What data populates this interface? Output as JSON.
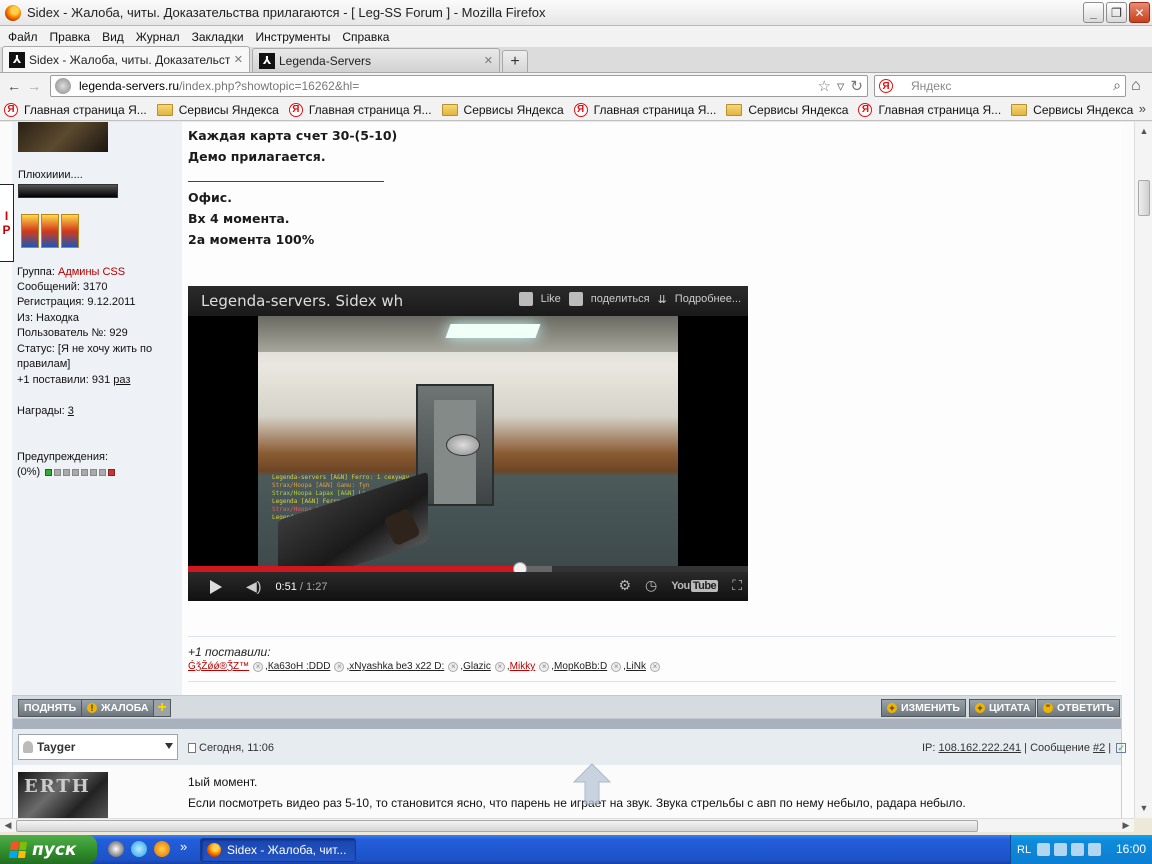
{
  "window": {
    "title": "Sidex - Жалоба, читы. Доказательства прилагаются - [ Leg-SS Forum ] - Mozilla Firefox",
    "min": "_",
    "max": "❐",
    "close": "✕"
  },
  "menu": [
    "Файл",
    "Правка",
    "Вид",
    "Журнал",
    "Закладки",
    "Инструменты",
    "Справка"
  ],
  "tabs": [
    {
      "label": "Sidex - Жалоба, читы. Доказательств...",
      "active": true
    },
    {
      "label": "Legenda-Servers",
      "active": false
    }
  ],
  "tab_close": "✕",
  "new_tab": "+",
  "nav": {
    "back": "←",
    "forward": "→",
    "url_host": "legenda-servers.ru",
    "url_path": "/index.php?showtopic=16262&hl=",
    "star": "☆",
    "reload": "↻",
    "search_placeholder": "Яндекс",
    "search_engine": "Я",
    "search_icon": "⌕",
    "home": "⌂"
  },
  "bookmarks": [
    {
      "type": "yandex",
      "label": "Главная страница Я..."
    },
    {
      "type": "folder",
      "label": "Сервисы Яндекса"
    },
    {
      "type": "yandex",
      "label": "Главная страница Я..."
    },
    {
      "type": "folder",
      "label": "Сервисы Яндекса"
    },
    {
      "type": "yandex",
      "label": "Главная страница Я..."
    },
    {
      "type": "folder",
      "label": "Сервисы Яндекса"
    },
    {
      "type": "yandex",
      "label": "Главная страница Я..."
    },
    {
      "type": "folder",
      "label": "Сервисы Яндекса"
    }
  ],
  "bookmarks_more": "»",
  "profile": {
    "signature_name": "Плюхииии....",
    "ip_badge": [
      "I",
      "P"
    ],
    "group_label": "Группа: ",
    "group_value": "Админы CSS",
    "posts": "Сообщений: 3170",
    "registered": "Регистрация: 9.12.2011",
    "from": "Из: Находка",
    "user_no": "Пользователь №: 929",
    "status": "Статус: [Я не хочу жить по правилам]",
    "plus_text": "+1 поставили: 931 ",
    "plus_link": "раз",
    "awards_text": "Награды: ",
    "awards_link": "3",
    "warnings_title": "Предупреждения:",
    "warnings_value": "(0%)"
  },
  "post": {
    "lines": [
      "Каждая карта счет 30-(5-10)",
      "Демо прилагается.",
      "Офис.",
      "Вх 4 момента.",
      "2а момента 100%"
    ]
  },
  "video": {
    "title": "Legenda-servers. Sidex wh",
    "like": "Like",
    "share": "поделиться",
    "more": "Подробнее...",
    "current_time": "0:51",
    "duration": "/ 1:27",
    "played_fraction": 0.593,
    "buffered_fraction": 0.65,
    "logo_text": "You",
    "logo_box": "Tube",
    "chat_lines": [
      {
        "text": "Legenda-servers [A&N] Ferro: 1 секунду",
        "color": "#d8d040"
      },
      {
        "text": "Strax/Hoopa [A&N] Gamu: fyn",
        "color": "#e0a040"
      },
      {
        "text": "Strax/Hoopa Lapax [A&N] Legenda Гамма",
        "color": "#b0d040"
      },
      {
        "text": "Legenda [A&N] Ferro: убит",
        "color": "#d8d040"
      },
      {
        "text": "Strax/Hoopa [A&N] Gamu: [A&N] Гамма",
        "color": "#e06060"
      },
      {
        "text": "Legenda [A&N] Ferro: [A&N] Гамма",
        "color": "#d8d040"
      }
    ]
  },
  "plus": {
    "title": "+1 поставили:",
    "users": [
      {
        "name": "ǴǯŽǿǿ®ǮZ™",
        "red": true
      },
      {
        "name": "Ка63оН :DDD",
        "red": false
      },
      {
        "name": "xNyashka be3 x22 D:",
        "red": false
      },
      {
        "name": "Glazic",
        "red": false
      },
      {
        "name": "Mikky",
        "red": true
      },
      {
        "name": "МорКоВb:D",
        "red": false
      },
      {
        "name": "LiNk",
        "red": false
      }
    ],
    "remove_icon": "×"
  },
  "actions": {
    "up": "ПОДНЯТЬ",
    "report": "ЖАЛОБА",
    "report_icon": "!",
    "add_icon": "+",
    "edit": "ИЗМЕНИТЬ",
    "quote": "ЦИТАТА",
    "reply": "ОТВЕТИТЬ",
    "edit_icon": "+",
    "quote_icon": "+",
    "reply_icon": "\""
  },
  "post2": {
    "username": "Tayger",
    "date": "Сегодня, 11:06",
    "ip_label": "IP: ",
    "ip_value": "108.162.222.241",
    "msg_label": " | Сообщение ",
    "msg_link": "#2",
    "msg_after": " |",
    "check": "✓",
    "avatar_text": "ERTH",
    "lines": [
      "1ый момент.",
      "Если посмотреть видео раз 5-10, то становится ясно, что парень не играет на звук. Звука стрельбы с авп по нему небыло, радара небыло."
    ]
  },
  "scroll": {
    "up": "▲",
    "down": "▼",
    "left": "◀",
    "right": "▶"
  },
  "taskbar": {
    "start": "пуск",
    "more": "»",
    "task_label": "Sidex - Жалоба, чит...",
    "lang": "RL",
    "clock": "16:00"
  },
  "colors": {
    "accent_red": "#cc181e",
    "admin_red": "#b00000",
    "taskbar_blue": "#245edb",
    "start_green": "#2e8b2a"
  }
}
